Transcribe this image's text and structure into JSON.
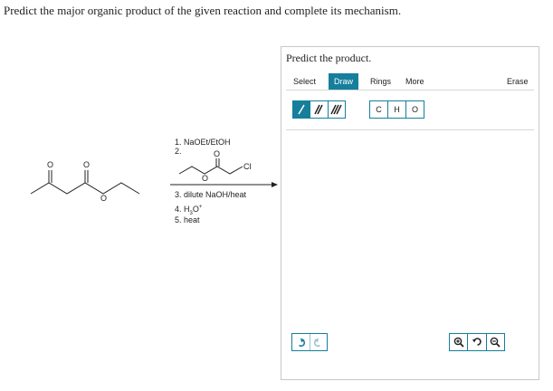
{
  "question": "Predict the major organic product of the given reaction and complete its mechanism.",
  "scheme": {
    "reactant_atoms": {
      "o1": "O",
      "o2": "O",
      "o3": "O"
    },
    "reagent_atoms": {
      "o_carbonyl": "O",
      "o_ester": "O",
      "cl": "Cl"
    },
    "conditions": {
      "step1": "1. NaOEt/EtOH",
      "step2": "2.",
      "step3": "3. dilute NaOH/heat",
      "step4_prefix": "4. H",
      "step4_sub": "3",
      "step4_main": "O",
      "step4_sup": "+",
      "step5": "5. heat"
    }
  },
  "panel": {
    "title": "Predict the product.",
    "tabs": {
      "select": "Select",
      "draw": "Draw",
      "rings": "Rings",
      "more": "More",
      "erase": "Erase"
    },
    "atoms": {
      "c": "C",
      "h": "H",
      "o": "O"
    },
    "accent_color": "#157f9c"
  }
}
